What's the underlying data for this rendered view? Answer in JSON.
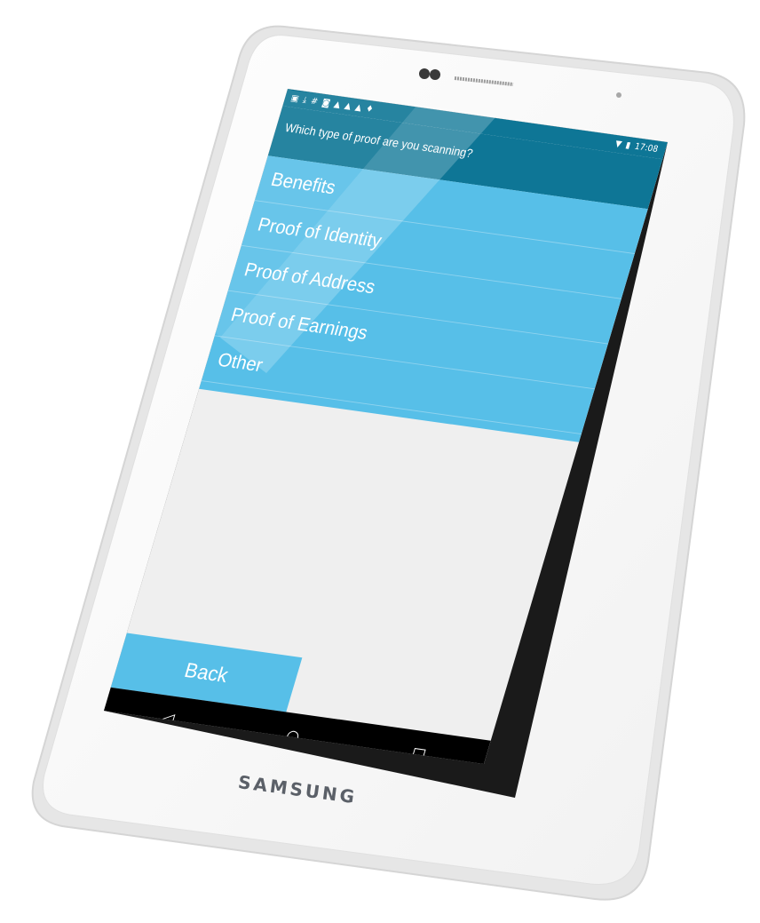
{
  "status_bar": {
    "left_icons": [
      "image-icon",
      "download-icon",
      "hash-icon",
      "instagram-icon",
      "warning-icon",
      "warning-icon",
      "warning-icon",
      "pin-icon"
    ],
    "time": "17:08"
  },
  "header": {
    "title": "Which type of proof are you scanning?"
  },
  "proof_types": [
    {
      "label": "Benefits"
    },
    {
      "label": "Proof of Identity"
    },
    {
      "label": "Proof of Address"
    },
    {
      "label": "Proof of Earnings"
    },
    {
      "label": "Other"
    }
  ],
  "back_button": {
    "label": "Back"
  },
  "device": {
    "brand": "SAMSUNG"
  },
  "colors": {
    "accent": "#57bfe8",
    "header": "#0e7696",
    "background": "#efefef",
    "nav_bar": "#000000"
  }
}
